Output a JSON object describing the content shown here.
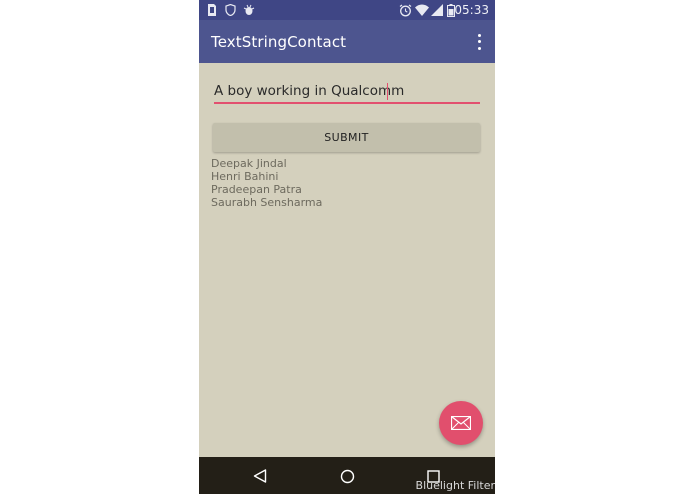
{
  "status_bar": {
    "time": "05:33",
    "left_icons": [
      "sim-icon",
      "shield-icon",
      "android-debug-icon"
    ],
    "right_icons": [
      "alarm-icon",
      "wifi-icon",
      "signal-icon",
      "battery-icon"
    ]
  },
  "app_bar": {
    "title": "TextStringContact",
    "menu_icon": "more-vert-icon"
  },
  "form": {
    "input_value": "A boy working in Qualcomm",
    "submit_label": "SUBMIT"
  },
  "contacts": [
    "Deepak Jindal",
    "Henri Bahini",
    "Pradeepan Patra",
    "Saurabh Sensharma"
  ],
  "fab": {
    "icon": "mail-icon"
  },
  "nav_bar": {
    "icons": [
      "back-icon",
      "home-icon",
      "recents-icon"
    ]
  },
  "overlay": {
    "bluelight_label": "Bluelight Filter"
  },
  "colors": {
    "status_bar": "#3f4685",
    "app_bar": "#4d558f",
    "background": "#d4d0bd",
    "accent": "#e2506f",
    "button": "#c2bfac",
    "nav_bar": "#231f17"
  }
}
